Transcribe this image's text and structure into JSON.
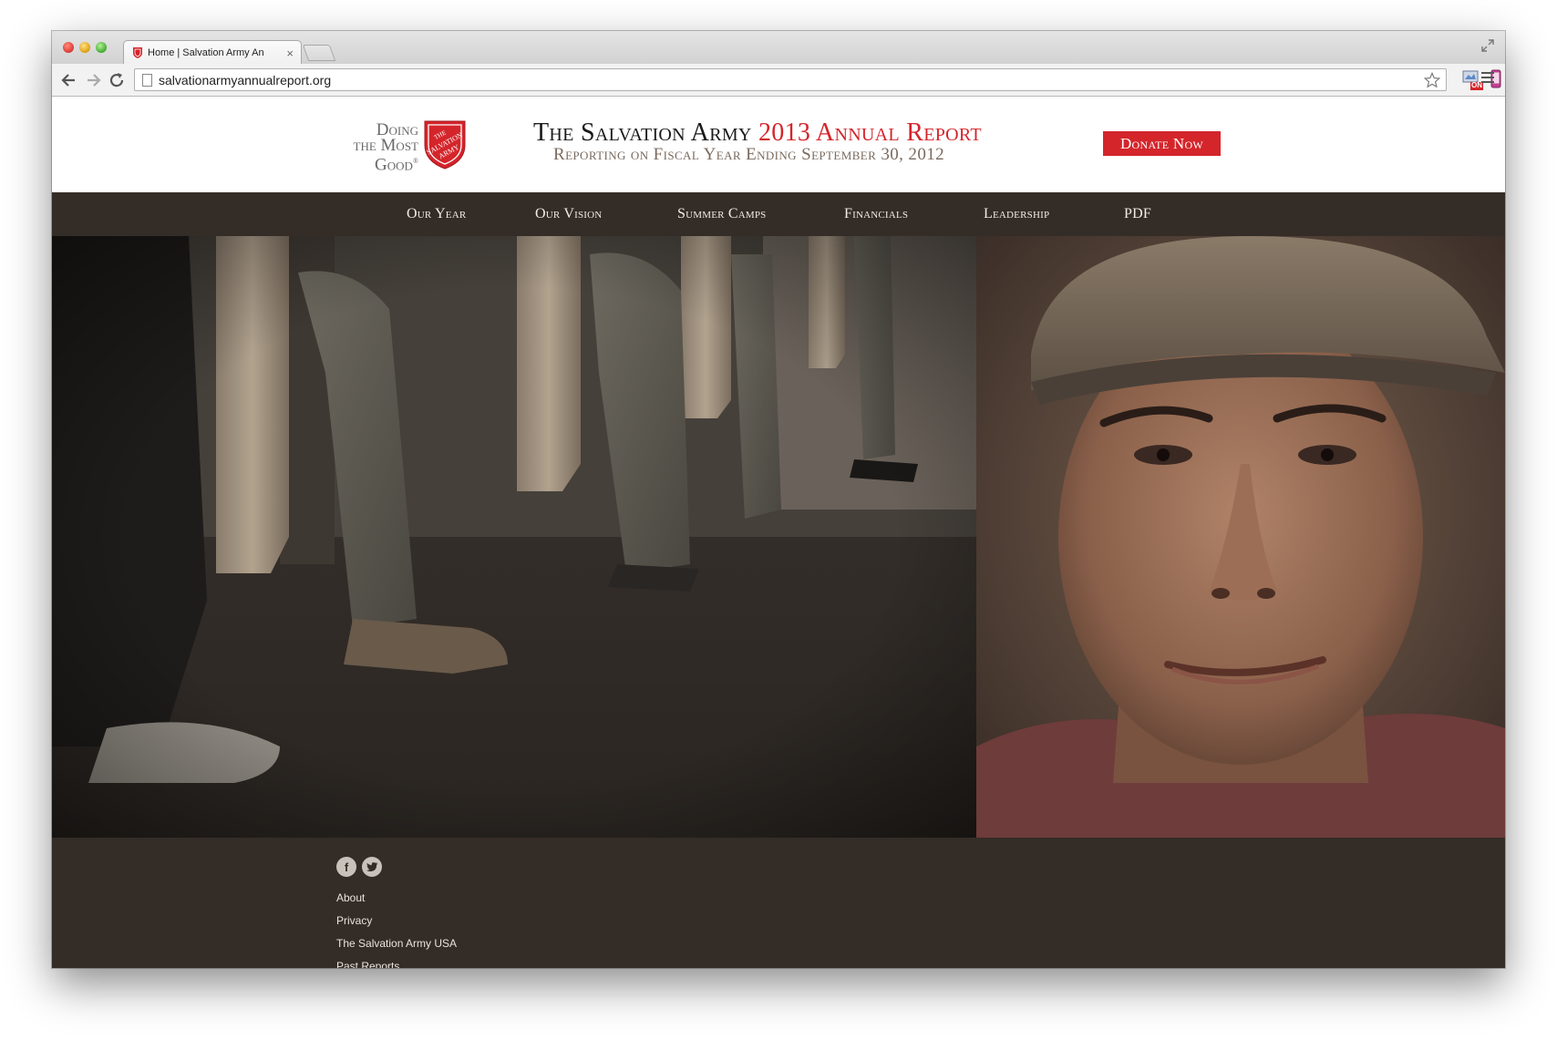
{
  "browser": {
    "tab_title": "Home | Salvation Army An",
    "tab_close": "×",
    "url": "salvationarmyannualreport.org",
    "extension_badge": "ON"
  },
  "header": {
    "tagline_line1": "Doing",
    "tagline_line2": "the Most",
    "tagline_line3": "Good",
    "tagline_mark": "®",
    "shield_text_1": "THE",
    "shield_text_2": "SALVATION",
    "shield_text_3": "ARMY",
    "title_main": "The Salvation Army ",
    "title_highlight": "2013 Annual Report",
    "subtitle": "Reporting on Fiscal Year Ending September 30, 2012",
    "donate_label": "Donate Now"
  },
  "nav": {
    "items": [
      {
        "label": "Our Year"
      },
      {
        "label": "Our Vision"
      },
      {
        "label": "Summer Camps"
      },
      {
        "label": "Financials"
      },
      {
        "label": "Leadership"
      },
      {
        "label": "PDF"
      }
    ]
  },
  "footer": {
    "facebook_glyph": "f",
    "twitter_glyph": "t",
    "links": [
      {
        "label": "About"
      },
      {
        "label": "Privacy"
      },
      {
        "label": "The Salvation Army USA"
      },
      {
        "label": "Past Reports"
      }
    ]
  },
  "colors": {
    "brand_red": "#d4252b",
    "nav_bg": "#342d27"
  }
}
